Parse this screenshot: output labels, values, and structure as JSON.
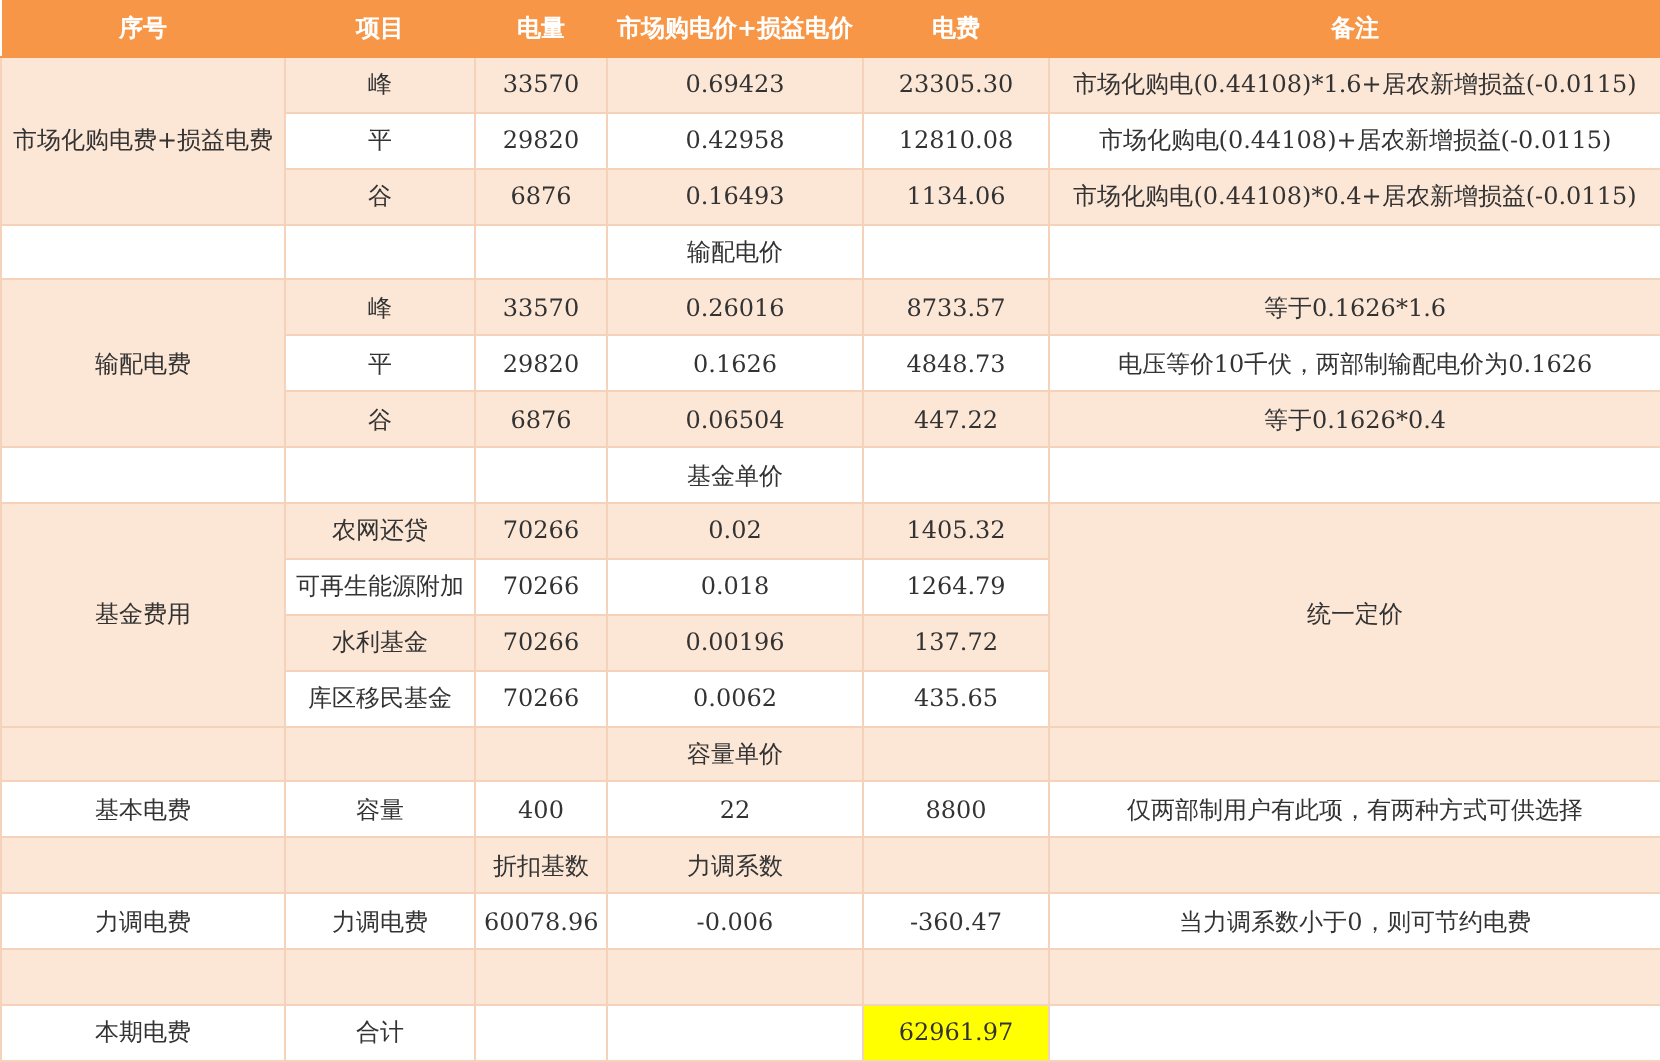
{
  "columns": [
    "序号",
    "项目",
    "电量",
    "市场购电价+损益电价",
    "电费",
    "备注"
  ],
  "sections": [
    {
      "kind": "group",
      "label": "市场化购电费+损益电费",
      "rows": [
        {
          "item": "峰",
          "qty": "33570",
          "price": "0.69423",
          "fee": "23305.30",
          "note": "市场化购电(0.44108)*1.6+居农新增损益(-0.0115)"
        },
        {
          "item": "平",
          "qty": "29820",
          "price": "0.42958",
          "fee": "12810.08",
          "note": "市场化购电(0.44108)+居农新增损益(-0.0115)"
        },
        {
          "item": "谷",
          "qty": "6876",
          "price": "0.16493",
          "fee": "1134.06",
          "note": "市场化购电(0.44108)*0.4+居农新增损益(-0.0115)"
        }
      ]
    },
    {
      "kind": "subheader",
      "price": "输配电价"
    },
    {
      "kind": "group",
      "label": "输配电费",
      "rows": [
        {
          "item": "峰",
          "qty": "33570",
          "price": "0.26016",
          "fee": "8733.57",
          "note": "等于0.1626*1.6"
        },
        {
          "item": "平",
          "qty": "29820",
          "price": "0.1626",
          "fee": "4848.73",
          "note": "电压等价10千伏，两部制输配电价为0.1626"
        },
        {
          "item": "谷",
          "qty": "6876",
          "price": "0.06504",
          "fee": "447.22",
          "note": "等于0.1626*0.4"
        }
      ]
    },
    {
      "kind": "subheader",
      "price": "基金单价"
    },
    {
      "kind": "group",
      "label": "基金费用",
      "note": "统一定价",
      "rows": [
        {
          "item": "农网还贷",
          "qty": "70266",
          "price": "0.02",
          "fee": "1405.32"
        },
        {
          "item": "可再生能源附加",
          "qty": "70266",
          "price": "0.018",
          "fee": "1264.79"
        },
        {
          "item": "水利基金",
          "qty": "70266",
          "price": "0.00196",
          "fee": "137.72"
        },
        {
          "item": "库区移民基金",
          "qty": "70266",
          "price": "0.0062",
          "fee": "435.65"
        }
      ]
    },
    {
      "kind": "subheader",
      "price": "容量单价"
    },
    {
      "kind": "group",
      "label": "基本电费",
      "rows": [
        {
          "item": "容量",
          "qty": "400",
          "price": "22",
          "fee": "8800",
          "note": "仅两部制用户有此项，有两种方式可供选择"
        }
      ]
    },
    {
      "kind": "subheader",
      "qty": "折扣基数",
      "price": "力调系数"
    },
    {
      "kind": "group",
      "label": "力调电费",
      "rows": [
        {
          "item": "力调电费",
          "qty": "60078.96",
          "price": "-0.006",
          "fee": "-360.47",
          "note": "当力调系数小于0，则可节约电费"
        }
      ]
    },
    {
      "kind": "blank"
    },
    {
      "kind": "group",
      "label": "本期电费",
      "rows": [
        {
          "item": "合计",
          "fee": "62961.97",
          "highlight": true
        }
      ]
    }
  ]
}
